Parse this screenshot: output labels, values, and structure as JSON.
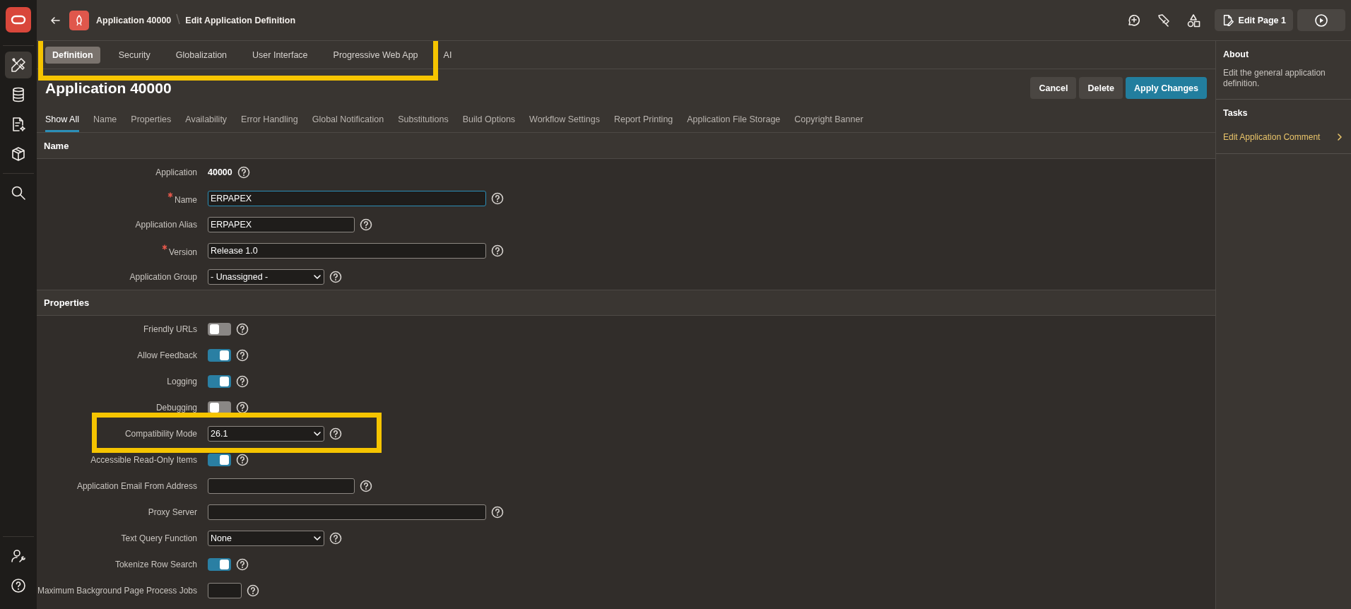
{
  "rail": {
    "top": [
      {
        "selected": true
      },
      {
        "selected": false
      },
      {
        "selected": false
      },
      {
        "selected": false
      },
      {
        "selected": false
      }
    ],
    "bottom": [
      {
        "selected": false
      },
      {
        "selected": false
      }
    ]
  },
  "header": {
    "breadcrumb": [
      "Application 40000",
      "Edit Application Definition"
    ],
    "edit_page_button": "Edit Page 1"
  },
  "tabs": {
    "highlighted": true,
    "items": [
      {
        "label": "Definition",
        "selected": true
      },
      {
        "label": "Security",
        "selected": false
      },
      {
        "label": "Globalization",
        "selected": false
      },
      {
        "label": "User Interface",
        "selected": false
      },
      {
        "label": "Progressive Web App",
        "selected": false
      },
      {
        "label": "AI",
        "selected": false
      }
    ]
  },
  "title": "Application 40000",
  "buttons": [
    {
      "label": "Cancel",
      "kind": "secondary"
    },
    {
      "label": "Delete",
      "kind": "secondary"
    },
    {
      "label": "Apply Changes",
      "kind": "primary"
    }
  ],
  "subtabs": [
    {
      "label": "Show All",
      "selected": true
    },
    {
      "label": "Name",
      "selected": false
    },
    {
      "label": "Properties",
      "selected": false
    },
    {
      "label": "Availability",
      "selected": false
    },
    {
      "label": "Error Handling",
      "selected": false
    },
    {
      "label": "Global Notification",
      "selected": false
    },
    {
      "label": "Substitutions",
      "selected": false
    },
    {
      "label": "Build Options",
      "selected": false
    },
    {
      "label": "Workflow Settings",
      "selected": false
    },
    {
      "label": "Report Printing",
      "selected": false
    },
    {
      "label": "Application File Storage",
      "selected": false
    },
    {
      "label": "Copyright Banner",
      "selected": false
    }
  ],
  "sections": [
    {
      "title": "Name",
      "fields": [
        {
          "label": "Application",
          "kind": "display",
          "value": "40000",
          "required": false
        },
        {
          "label": "Name",
          "kind": "input",
          "value": "ERPAPEX",
          "required": true,
          "focused": true
        },
        {
          "label": "Application Alias",
          "kind": "short-input",
          "value": "ERPAPEX",
          "required": false,
          "focused": false
        },
        {
          "label": "Version",
          "kind": "input",
          "value": "Release 1.0",
          "required": true,
          "focused": false
        },
        {
          "label": "Application Group",
          "kind": "select",
          "value": "- Unassigned -",
          "required": false
        }
      ]
    },
    {
      "title": "Properties",
      "fields": [
        {
          "label": "Friendly URLs",
          "kind": "toggle",
          "on": false,
          "required": false
        },
        {
          "label": "Allow Feedback",
          "kind": "toggle",
          "on": true,
          "required": false
        },
        {
          "label": "Logging",
          "kind": "toggle",
          "on": true,
          "required": false
        },
        {
          "label": "Debugging",
          "kind": "toggle",
          "on": false,
          "required": false
        },
        {
          "label": "Compatibility Mode",
          "kind": "select",
          "value": "26.1",
          "required": false,
          "highlighted": true
        },
        {
          "label": "Accessible Read-Only Items",
          "kind": "toggle",
          "on": true,
          "required": false
        },
        {
          "label": "Application Email From Address",
          "kind": "short-input",
          "required": false,
          "focused": false
        },
        {
          "label": "Proxy Server",
          "kind": "input",
          "required": false,
          "focused": false
        },
        {
          "label": "Text Query Function",
          "kind": "select",
          "value": "None",
          "required": false
        },
        {
          "label": "Tokenize Row Search",
          "kind": "toggle",
          "on": true,
          "required": false
        },
        {
          "label": "Maximum Background Page Process Jobs",
          "kind": "number-input",
          "required": false,
          "focused": false
        }
      ]
    }
  ],
  "side": {
    "about_title": "About",
    "about_text": "Edit the general application definition.",
    "tasks_title": "Tasks",
    "tasks": [
      "Edit Application Comment"
    ]
  }
}
